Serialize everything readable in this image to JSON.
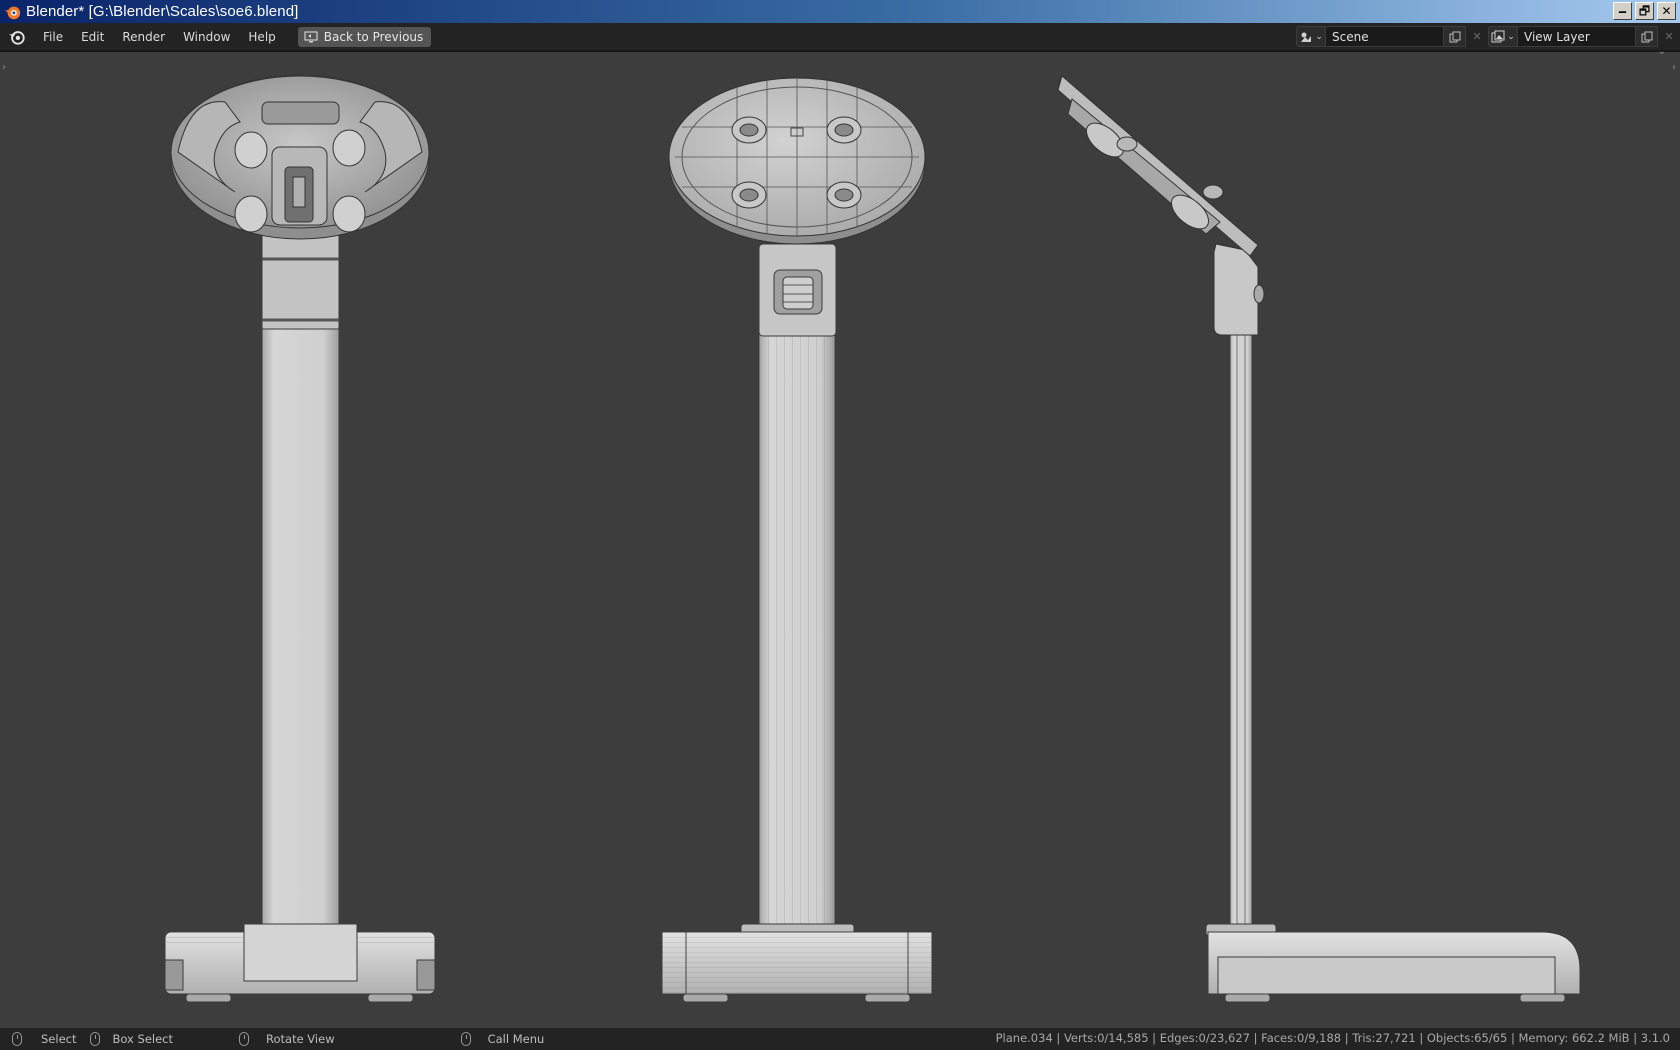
{
  "window": {
    "title": "Blender* [G:\\Blender\\Scales\\soe6.blend]",
    "minimize": "🗕",
    "restore": "🗗",
    "close": "✕"
  },
  "menu": {
    "items": [
      "File",
      "Edit",
      "Render",
      "Window",
      "Help"
    ],
    "back_to_previous": "Back to Previous"
  },
  "scene": {
    "label": "Scene",
    "view_layer": "View Layer"
  },
  "statusbar": {
    "select": "Select",
    "box_select": "Box Select",
    "rotate_view": "Rotate View",
    "call_menu": "Call Menu",
    "stats": "Plane.034 | Verts:0/14,585 | Edges:0/23,627 | Faces:0/9,188 | Tris:27,721 | Objects:65/65 | Memory: 662.2 MiB | 3.1.0"
  },
  "icons": {
    "blender_logo": "blender-logo-icon",
    "scene_selector": "scene-icon",
    "view_layer_selector": "view-layer-icon",
    "duplicate": "duplicate-icon",
    "remove": "close-icon",
    "mouse": "mouse-icon"
  },
  "colors": {
    "viewport_bg": "#3d3d3d",
    "model_fill": "#c9c9c9",
    "model_shadow": "#9a9a9a",
    "wire": "#3a3a3a"
  }
}
